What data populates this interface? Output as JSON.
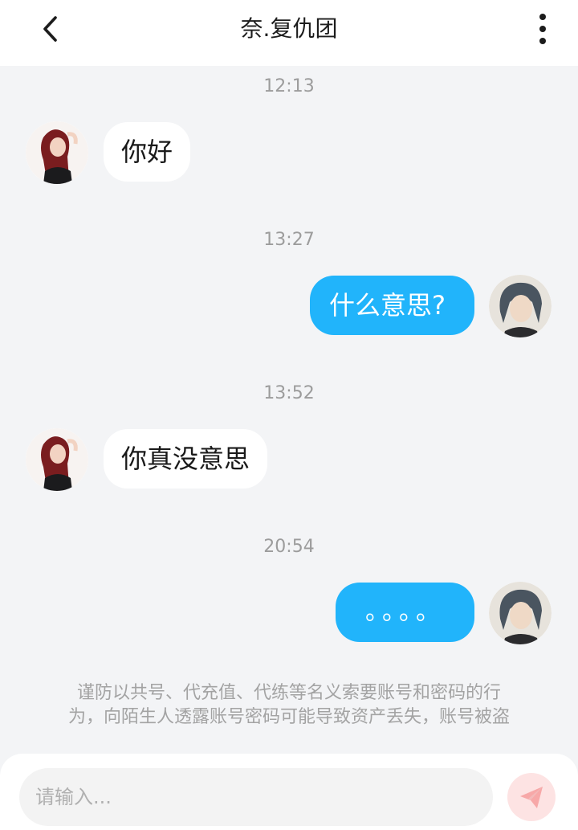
{
  "header": {
    "title": "​奈.复仇团",
    "back_icon": "chevron-left-icon",
    "more_icon": "more-vertical-icon"
  },
  "messages": [
    {
      "time": "12:13",
      "direction": "in",
      "text": "你好"
    },
    {
      "time": "13:27",
      "direction": "out",
      "text": "什么意思?"
    },
    {
      "time": "13:52",
      "direction": "in",
      "text": "你真没意思"
    },
    {
      "time": "20:54",
      "direction": "out",
      "text": "。。。。"
    }
  ],
  "notice": {
    "line1": "谨防以共号、代充值、代练等名义索要账号和密码的行",
    "line2": "为，向陌生人透露账号密码可能导致资产丢失，账号被盗"
  },
  "composer": {
    "placeholder": "请输入...",
    "send_icon": "paper-plane-icon"
  },
  "colors": {
    "outgoing_bubble": "#21b4fb",
    "incoming_bubble": "#ffffff",
    "background": "#f3f4f6",
    "send_button": "#fde3e3"
  }
}
